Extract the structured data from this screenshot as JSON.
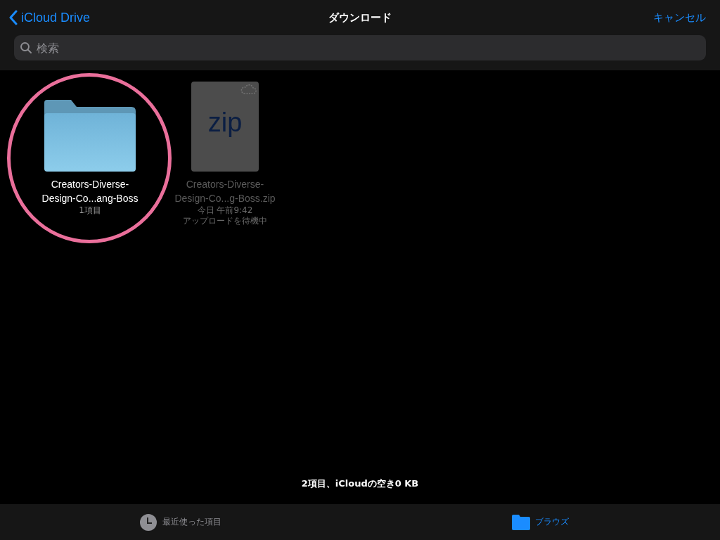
{
  "nav": {
    "back": "iCloud Drive",
    "title": "ダウンロード",
    "cancel": "キャンセル"
  },
  "search": {
    "placeholder": "検索"
  },
  "items": [
    {
      "kind": "folder",
      "name": "Creators-Diverse-\nDesign-Co...ang-Boss",
      "details": [
        "1項目"
      ],
      "dimmed": false,
      "highlighted": true
    },
    {
      "kind": "zip",
      "name": "Creators-Diverse-\nDesign-Co...g-Boss.zip",
      "icon_label": "zip",
      "details": [
        "今日 午前9:42",
        "アップロードを待機中"
      ],
      "dimmed": true,
      "highlighted": false
    }
  ],
  "summary": "2項目、iCloudの空き0 KB",
  "tabs": [
    {
      "kind": "recent",
      "label": "最近使った項目",
      "selected": false
    },
    {
      "kind": "browse",
      "label": "ブラウズ",
      "selected": true
    }
  ]
}
